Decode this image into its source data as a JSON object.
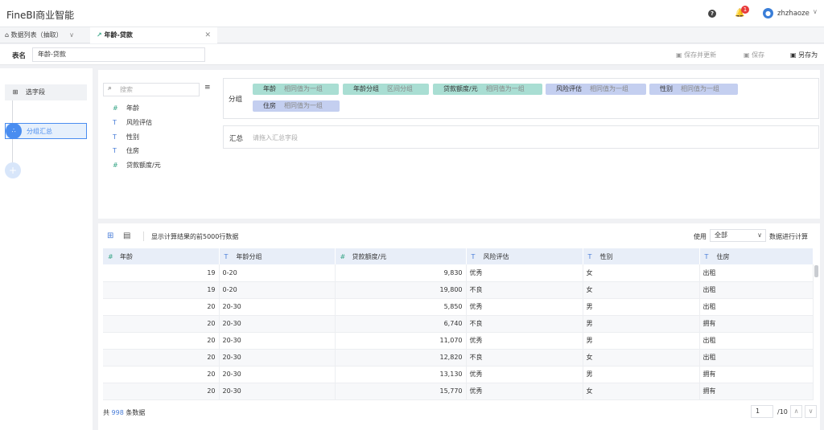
{
  "app": {
    "title": "FineBI商业智能"
  },
  "header": {
    "notification_count": "1",
    "username": "zhzhaoze"
  },
  "tabs": [
    {
      "label": "数据列表（抽取）"
    },
    {
      "label": "年龄-贷款"
    }
  ],
  "namebar": {
    "label": "表名",
    "value": "年龄-贷款",
    "save_update": "保存并更新",
    "save": "保存",
    "save_as": "另存为"
  },
  "steps": [
    {
      "label": "选字段"
    },
    {
      "label": "分组汇总"
    }
  ],
  "fields_panel": {
    "search_placeholder": "搜索",
    "fields": [
      {
        "type": "#",
        "name": "年龄"
      },
      {
        "type": "T",
        "name": "风险评估"
      },
      {
        "type": "T",
        "name": "性别"
      },
      {
        "type": "T",
        "name": "住房"
      },
      {
        "type": "#",
        "name": "贷款额度/元"
      }
    ]
  },
  "group": {
    "label": "分组",
    "pills": [
      {
        "name": "年龄",
        "mode": "相同值为一组",
        "color": "#a9ded3"
      },
      {
        "name": "年龄分组",
        "mode": "区间分组",
        "color": "#a9ded3"
      },
      {
        "name": "贷款额度/元",
        "mode": "相同值为一组",
        "color": "#a9ded3"
      },
      {
        "name": "风险评估",
        "mode": "相同值为一组",
        "color": "#c4cff0"
      },
      {
        "name": "性别",
        "mode": "相同值为一组",
        "color": "#c4cff0"
      },
      {
        "name": "住房",
        "mode": "相同值为一组",
        "color": "#c4cff0"
      }
    ]
  },
  "summary": {
    "label": "汇总",
    "placeholder": "请拖入汇总字段"
  },
  "preview": {
    "show_text": "显示计算结果的前5000行数据",
    "use_label": "使用",
    "use_value": "全部",
    "calc_label": "数据进行计算"
  },
  "table": {
    "columns": [
      {
        "type": "#",
        "name": "年龄"
      },
      {
        "type": "T",
        "name": "年龄分组"
      },
      {
        "type": "#",
        "name": "贷款额度/元"
      },
      {
        "type": "T",
        "name": "风险评估"
      },
      {
        "type": "T",
        "name": "性别"
      },
      {
        "type": "T",
        "name": "住房"
      }
    ],
    "rows": [
      [
        "19",
        "0-20",
        "9,830",
        "优秀",
        "女",
        "出租"
      ],
      [
        "19",
        "0-20",
        "19,800",
        "不良",
        "女",
        "出租"
      ],
      [
        "20",
        "20-30",
        "5,850",
        "优秀",
        "男",
        "出租"
      ],
      [
        "20",
        "20-30",
        "6,740",
        "不良",
        "男",
        "拥有"
      ],
      [
        "20",
        "20-30",
        "11,070",
        "优秀",
        "男",
        "出租"
      ],
      [
        "20",
        "20-30",
        "12,820",
        "不良",
        "女",
        "出租"
      ],
      [
        "20",
        "20-30",
        "13,130",
        "优秀",
        "男",
        "拥有"
      ],
      [
        "20",
        "20-30",
        "15,770",
        "优秀",
        "女",
        "拥有"
      ]
    ]
  },
  "footer": {
    "prefix": "共",
    "count": "998",
    "suffix": "条数据",
    "page": "1",
    "total_pages": "/10"
  }
}
